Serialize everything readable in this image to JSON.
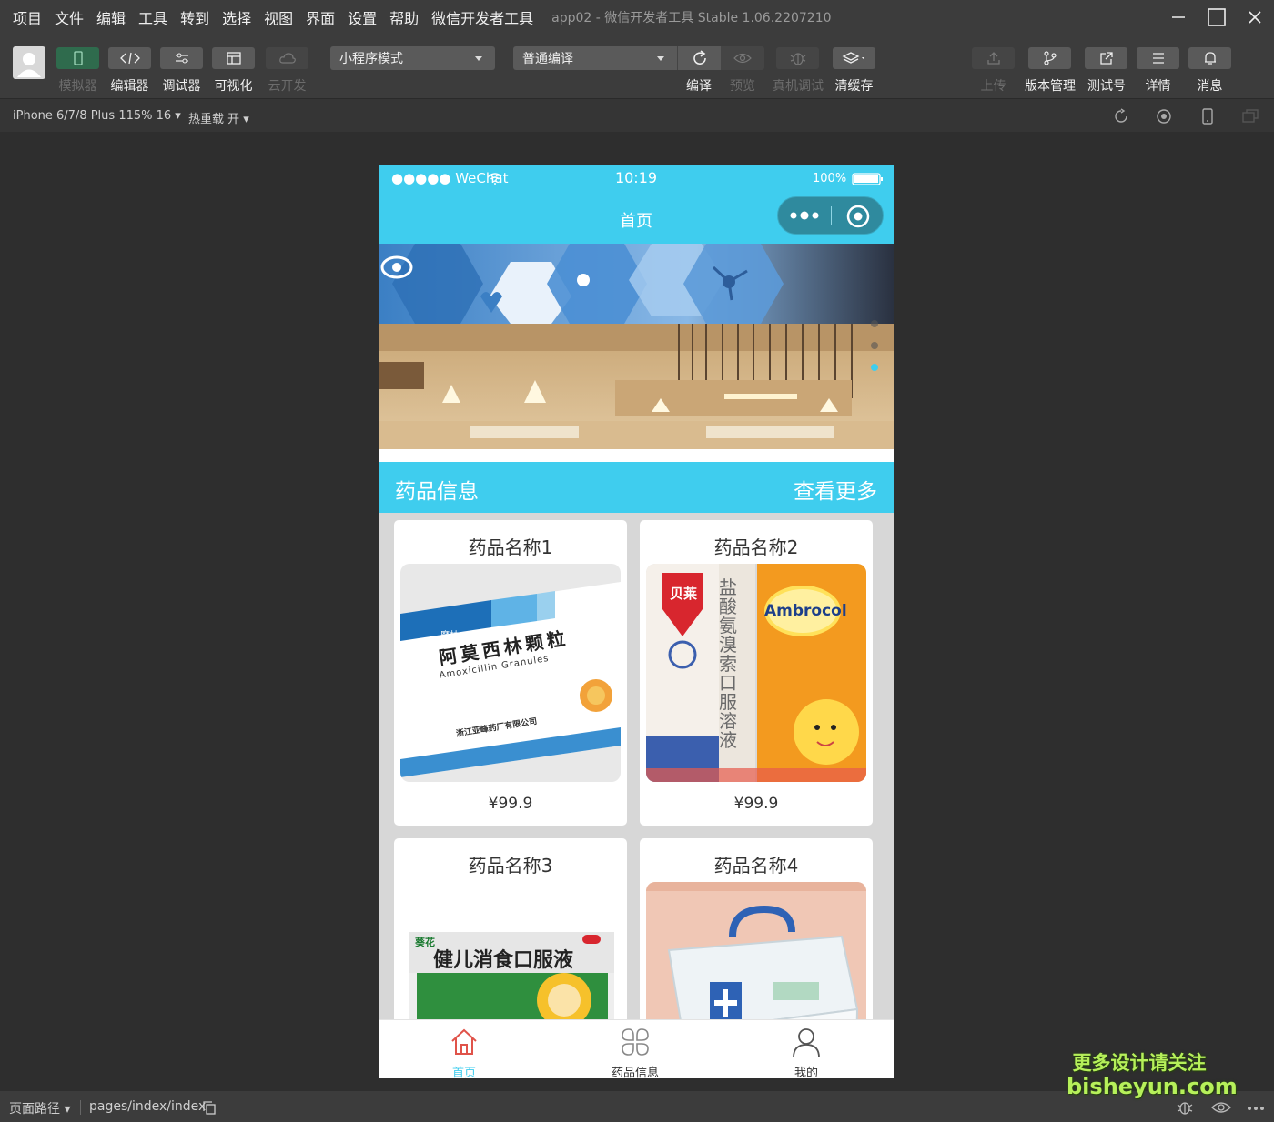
{
  "menu": {
    "items": [
      "项目",
      "文件",
      "编辑",
      "工具",
      "转到",
      "选择",
      "视图",
      "界面",
      "设置",
      "帮助",
      "微信开发者工具"
    ],
    "app_title": "app02 - 微信开发者工具 Stable 1.06.2207210"
  },
  "toolbar": {
    "simulator": "模拟器",
    "editor": "编辑器",
    "debugger": "调试器",
    "visual": "可视化",
    "cloud": "云开发",
    "mode_select": "小程序模式",
    "compile_select": "普通编译",
    "compile": "编译",
    "preview": "预览",
    "real_debug": "真机调试",
    "clear_cache": "清缓存",
    "upload": "上传",
    "version": "版本管理",
    "test_account": "测试号",
    "details": "详情",
    "messages": "消息"
  },
  "subbar": {
    "device": "iPhone 6/7/8 Plus 115% 16 ▾",
    "hot_reload": "热重载 开 ▾"
  },
  "phone": {
    "status": {
      "signal": "●●●●● WeChat",
      "time": "10:19",
      "battery": "100%"
    },
    "nav_title": "首页",
    "banner": {
      "dots": 3,
      "active_dot": 3
    },
    "section": {
      "title": "药品信息",
      "more": "查看更多"
    },
    "products": [
      {
        "name": "药品名称1",
        "price": "¥99.9",
        "box_brand": "摩林",
        "box_title": "阿莫西林颗粒",
        "box_en": "Amoxicillin Granules",
        "box_maker": "浙江亚峰药厂有限公司"
      },
      {
        "name": "药品名称2",
        "price": "¥99.9",
        "box_left_brand": "贝莱",
        "box_left_title": "盐酸氨溴索口服溶液",
        "box_right_brand": "Ambrocol"
      },
      {
        "name": "药品名称3",
        "box_brand": "葵花",
        "box_title": "健儿消食口服液"
      },
      {
        "name": "药品名称4"
      }
    ],
    "tabs": [
      {
        "label": "首页",
        "icon": "home-icon"
      },
      {
        "label": "药品信息",
        "icon": "grid-icon"
      },
      {
        "label": "我的",
        "icon": "user-icon"
      }
    ]
  },
  "footer": {
    "path_label": "页面路径 ▾",
    "path": "pages/index/index"
  },
  "watermark": {
    "line1": "更多设计请关注",
    "line2": "bisheyun.com"
  },
  "colors": {
    "accent": "#3fcdee",
    "active_green": "#2f6b4d",
    "tab_active": "#e0534a"
  }
}
